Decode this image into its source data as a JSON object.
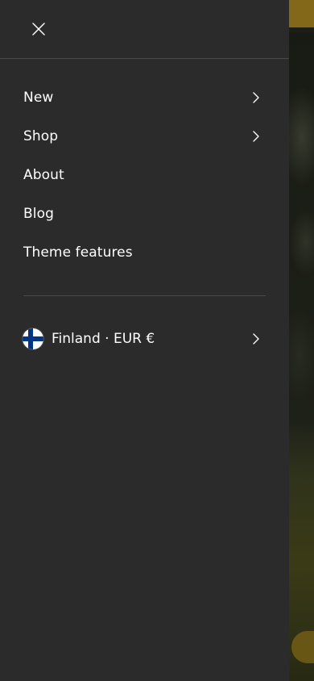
{
  "drawer": {
    "close_icon": "close-icon",
    "nav_items": [
      {
        "label": "New",
        "has_submenu": true
      },
      {
        "label": "Shop",
        "has_submenu": true
      },
      {
        "label": "About",
        "has_submenu": false
      },
      {
        "label": "Blog",
        "has_submenu": false
      },
      {
        "label": "Theme features",
        "has_submenu": false
      }
    ],
    "locale": {
      "label": "Finland · EUR €",
      "flag": "finland-flag-icon",
      "has_submenu": true
    }
  },
  "colors": {
    "drawer_background": "#2b2b2b",
    "text": "#ffffff",
    "divider": "#4a4a4a",
    "accent_yellow": "#c9a028",
    "flag_blue": "#003580"
  }
}
